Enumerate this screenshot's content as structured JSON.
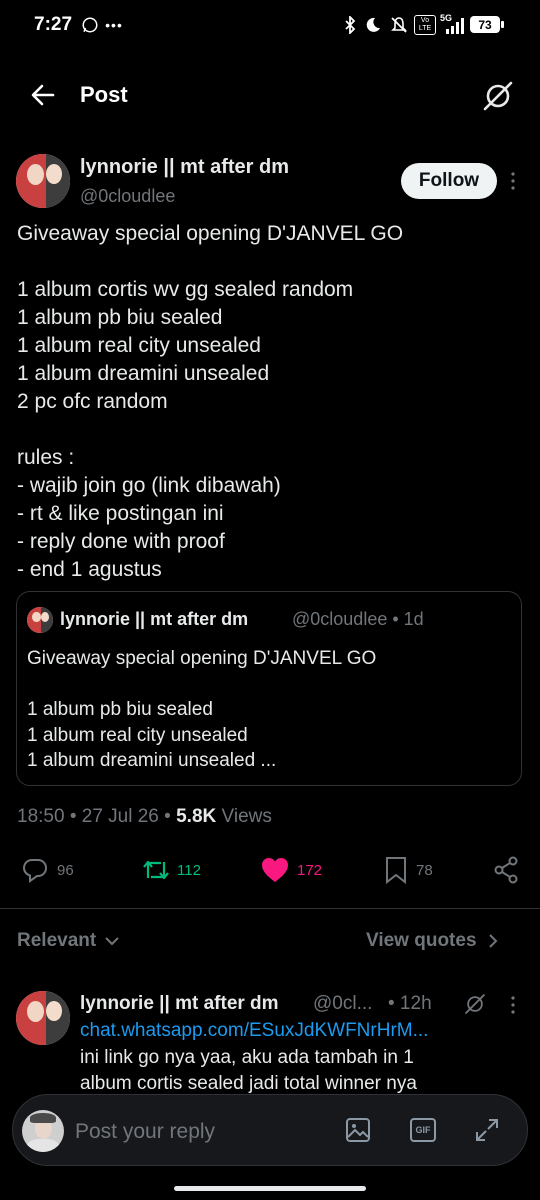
{
  "status_bar": {
    "time": "7:27",
    "network": "5G",
    "volte": "Vo LTE",
    "battery": "73"
  },
  "header": {
    "title": "Post"
  },
  "post": {
    "display_name": "lynnorie || mt after dm",
    "handle": "@0cloudlee",
    "follow_label": "Follow",
    "text": "Giveaway special opening D'JANVEL GO\n\n1 album cortis wv gg sealed random\n1 album pb biu sealed\n1 album real city unsealed\n1 album dreamini unsealed\n2 pc ofc random\n\nrules :\n- wajib join go (link dibawah)\n- rt & like postingan ini\n- reply done with proof\n- end 1 agustus",
    "quote": {
      "display_name": "lynnorie || mt after dm",
      "handle_time": "@0cloudlee • 1d",
      "text": "Giveaway special opening D'JANVEL GO\n\n1 album pb biu sealed\n1 album real city unsealed\n1 album dreamini unsealed ..."
    },
    "meta": {
      "time_date": "18:50 • 27 Jul 26 • ",
      "views_count": "5.8K",
      "views_label": " Views"
    },
    "actions": {
      "replies": "96",
      "reposts": "112",
      "likes": "172",
      "bookmarks": "78"
    }
  },
  "replies_section": {
    "sort_label": "Relevant",
    "view_quotes_label": "View quotes"
  },
  "reply": {
    "display_name": "lynnorie || mt after dm",
    "handle": "@0cl...",
    "time": "• 12h",
    "link": "chat.whatsapp.com/ESuxJdKWFNrHrM...",
    "line1": "ini link go nya yaa, aku ada tambah in 1",
    "line2": "album cortis sealed jadi total winner nya"
  },
  "composer": {
    "placeholder": "Post your reply",
    "gif_label": "GIF"
  },
  "colors": {
    "background": "#000000",
    "text": "#e7e9ea",
    "muted": "#71767b",
    "repost_green": "#00ba7c",
    "like_pink": "#f91880",
    "link_blue": "#1d9bf0"
  }
}
